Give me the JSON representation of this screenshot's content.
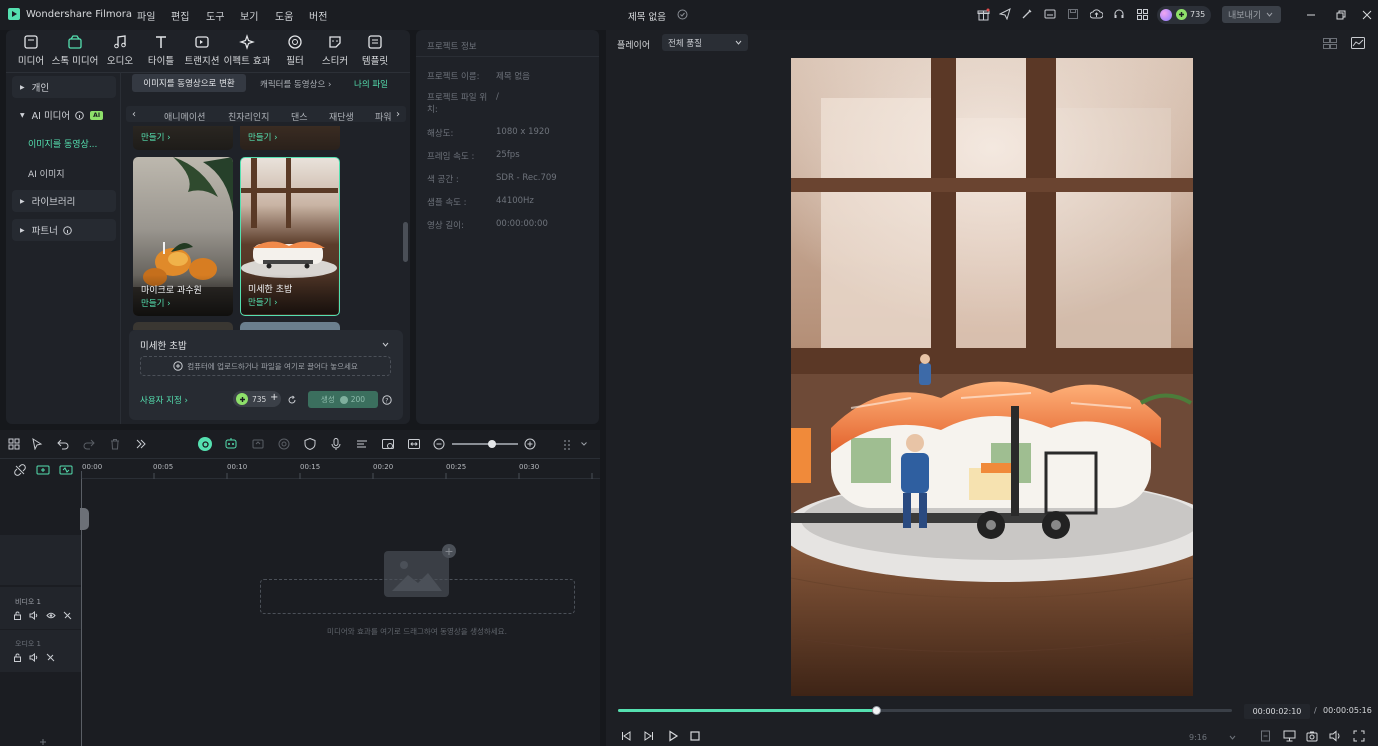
{
  "app": {
    "title": "Wondershare Filmora",
    "project_name": "제목 없음"
  },
  "menu": [
    "파일",
    "편집",
    "도구",
    "보기",
    "도움",
    "버전"
  ],
  "header": {
    "credits": "735",
    "export_label": "내보내기"
  },
  "toolbar": [
    "미디어",
    "스톡 미디어",
    "오디오",
    "타이틀",
    "트랜지션",
    "이펙트 효과",
    "필터",
    "스티커",
    "템플릿"
  ],
  "sidebar": {
    "personal": "개인",
    "ai_media": "AI 미디어",
    "ai_badge": "AI",
    "image_to_video": "이미지를 동영상...",
    "ai_image": "AI 이미지",
    "library": "라이브러리",
    "partner": "파트너"
  },
  "media_tabs": [
    "이미지를 동영상으로 변환",
    "캐릭터를 동영상으",
    "나의 파일"
  ],
  "categories": [
    "애니메이션",
    "친자리인지",
    "댄스",
    "재단생",
    "파워"
  ],
  "thumbs": {
    "make_label": "만들기",
    "item1_title": "마이크로 과수원",
    "item2_title": "미세한 초밥"
  },
  "generate_panel": {
    "title": "미세한 초밥",
    "upload_hint": "컴퓨터에 업로드하거나 파일을 여기로 끌어다 놓으세요",
    "custom_label": "사용자 지정",
    "credits": "735",
    "generate_label": "생성",
    "generate_cost": "200"
  },
  "project_info": {
    "header": "프로젝트 정보",
    "rows": [
      {
        "label": "프로젝트 이름:",
        "value": "제목 없음"
      },
      {
        "label": "프로젝트 파일 위치:",
        "value": "/"
      },
      {
        "label": "해상도:",
        "value": "1080 x 1920"
      },
      {
        "label": "프레임 속도 :",
        "value": "25fps"
      },
      {
        "label": "색 공간 :",
        "value": "SDR - Rec.709"
      },
      {
        "label": "샘플 속도 :",
        "value": "44100Hz"
      },
      {
        "label": "영상 길이:",
        "value": "00:00:00:00"
      }
    ]
  },
  "player": {
    "label": "플레이어",
    "quality": "전체 품질",
    "current_time": "00:00:02:10",
    "separator": "/",
    "total_time": "00:00:05:16",
    "progress": 0.42,
    "aspect": "9:16"
  },
  "timeline": {
    "ticks": [
      "00:00",
      "00:05",
      "00:10",
      "00:15",
      "00:20",
      "00:25",
      "00:30"
    ],
    "video_track": "비디오 1",
    "audio_track": "오디오 1",
    "drop_hint": "미디어와 효과를 여기로 드래그하여 동영상을 생성하세요."
  },
  "colors": {
    "accent": "#55e0b0",
    "background": "#16181c",
    "panel": "#1f2228"
  }
}
